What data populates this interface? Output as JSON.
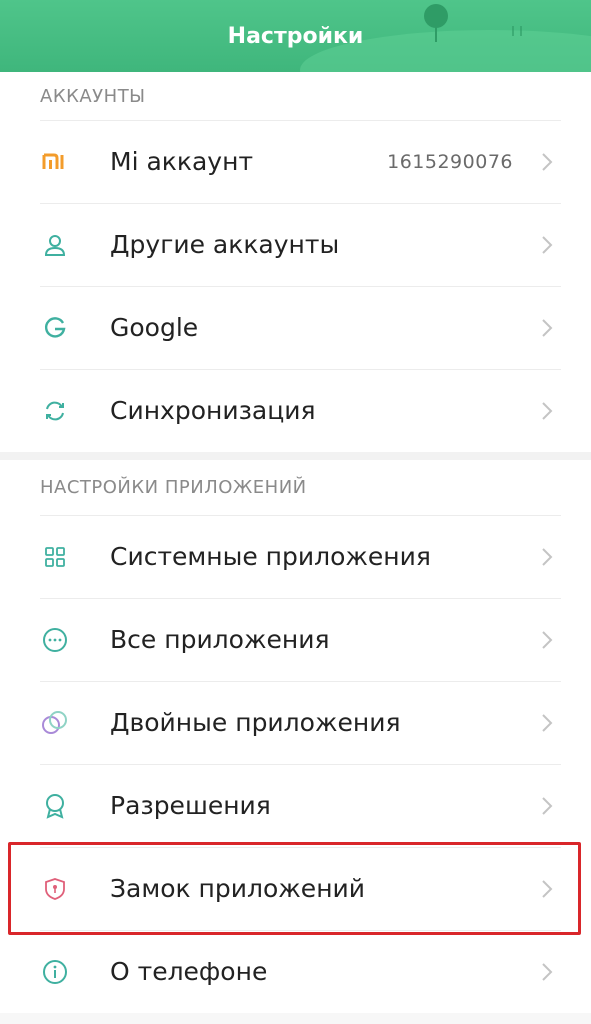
{
  "header": {
    "title": "Настройки"
  },
  "accounts": {
    "heading": "АККАУНТЫ",
    "items": [
      {
        "label": "Mi аккаунт",
        "value": "1615290076",
        "icon": "mi-logo-icon"
      },
      {
        "label": "Другие аккаунты",
        "icon": "person-icon"
      },
      {
        "label": "Google",
        "icon": "google-g-icon"
      },
      {
        "label": "Синхронизация",
        "icon": "sync-icon"
      }
    ]
  },
  "apps": {
    "heading": "НАСТРОЙКИ ПРИЛОЖЕНИЙ",
    "items": [
      {
        "label": "Системные приложения",
        "icon": "grid-icon"
      },
      {
        "label": "Все приложения",
        "icon": "dots-circle-icon"
      },
      {
        "label": "Двойные приложения",
        "icon": "dual-circles-icon"
      },
      {
        "label": "Разрешения",
        "icon": "badge-icon"
      },
      {
        "label": "Замок приложений",
        "icon": "shield-lock-icon"
      },
      {
        "label": "О телефоне",
        "icon": "info-icon"
      }
    ]
  },
  "colors": {
    "header": "#3fb67c",
    "icon_teal": "#3fb0a0",
    "mi_orange": "#f39c2b",
    "highlight_red": "#d9262a"
  }
}
